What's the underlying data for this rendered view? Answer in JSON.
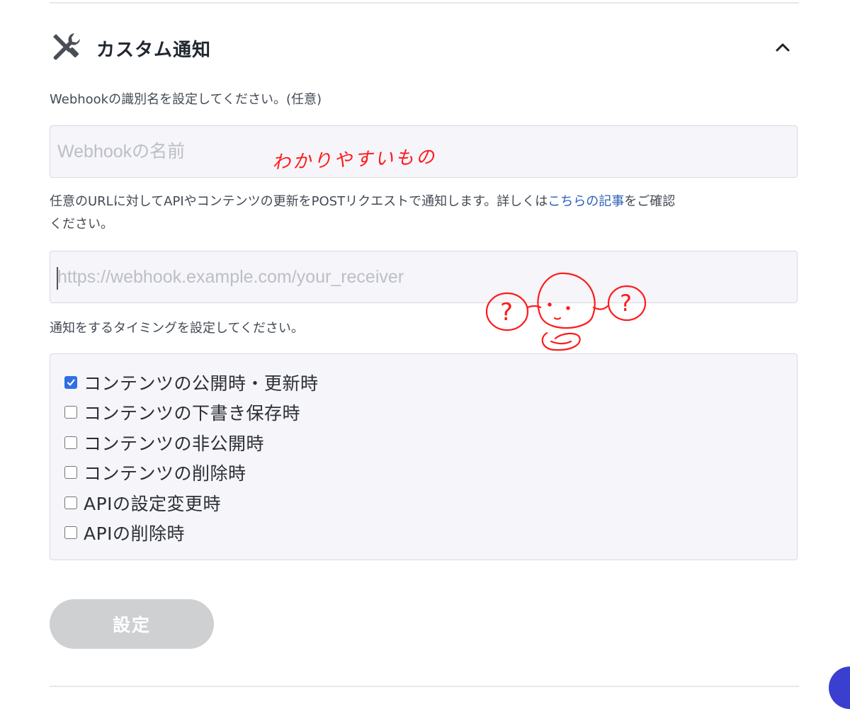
{
  "section": {
    "title": "カスタム通知"
  },
  "webhook_name": {
    "label": "Webhookの識別名を設定してください。(任意)",
    "placeholder": "Webhookの名前",
    "value": ""
  },
  "webhook_url": {
    "description_before": "任意のURLに対してAPIやコンテンツの更新をPOSTリクエストで通知します。詳しくは",
    "link_text": "こちらの記事",
    "description_after": "をご確認",
    "description_line2": "ください。",
    "placeholder": "https://webhook.example.com/your_receiver",
    "value": ""
  },
  "timing": {
    "label": "通知をするタイミングを設定してください。",
    "options": [
      {
        "label": "コンテンツの公開時・更新時",
        "checked": true
      },
      {
        "label": "コンテンツの下書き保存時",
        "checked": false
      },
      {
        "label": "コンテンツの非公開時",
        "checked": false
      },
      {
        "label": "コンテンツの削除時",
        "checked": false
      },
      {
        "label": "APIの設定変更時",
        "checked": false
      },
      {
        "label": "APIの削除時",
        "checked": false
      }
    ]
  },
  "submit": {
    "label": "設定",
    "enabled": false
  },
  "annotation": {
    "handwritten_note": "わかりやすいもの",
    "question_marks": [
      "?",
      "?"
    ],
    "color": "#ff1a1a"
  },
  "colors": {
    "accent": "#2f6fe4",
    "link": "#2d62b9",
    "input_bg": "#f5f5fa",
    "button_disabled": "#cfd0d2"
  }
}
